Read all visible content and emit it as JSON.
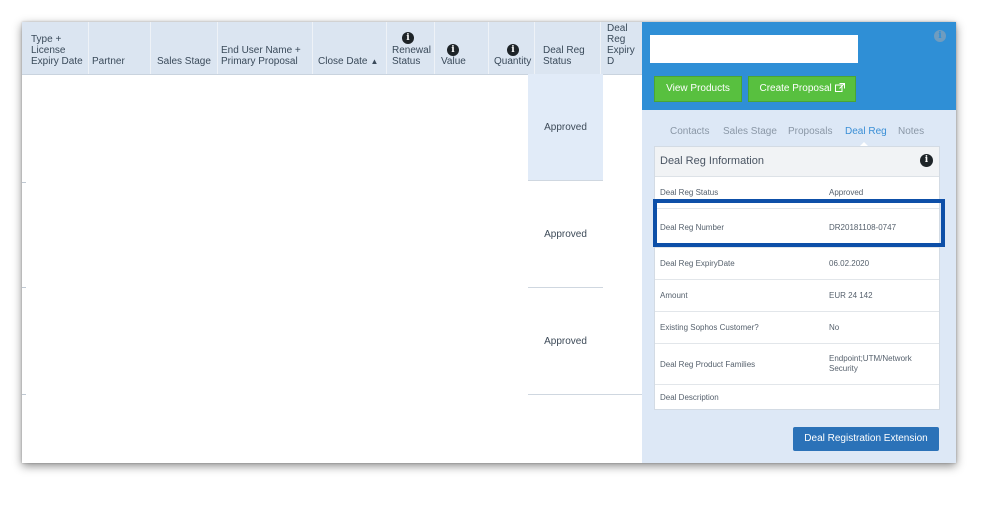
{
  "table": {
    "headers": {
      "type": "Type +",
      "license": "License",
      "expiry": "Expiry Date",
      "partner": "Partner",
      "sales_stage": "Sales Stage",
      "end_user": "End User Name +",
      "primary_proposal": "Primary Proposal",
      "close_date": "Close Date",
      "renewal": "Renewal",
      "renewal_status": "Status",
      "value": "Value",
      "quantity": "Quantity",
      "deal_reg": "Deal Reg",
      "deal_reg_status": "Status",
      "deal_reg_exp": "Deal Reg",
      "deal_reg_exp2": "Expiry D"
    },
    "sort_icon": "▲",
    "rows": [
      {
        "deal_reg_status": "Approved"
      },
      {
        "deal_reg_status": "Approved"
      },
      {
        "deal_reg_status": "Approved"
      }
    ]
  },
  "panel": {
    "view_products": "View Products",
    "create_proposal": "Create Proposal",
    "external_icon": "external-link-icon",
    "tabs": [
      "Contacts",
      "Sales Stage",
      "Proposals",
      "Deal Reg",
      "Notes"
    ],
    "active_tab": "Deal Reg",
    "section_title": "Deal Reg Information",
    "fields": [
      {
        "label": "Deal Reg Status",
        "value": "Approved"
      },
      {
        "label": "Deal Reg Number",
        "value": "DR20181108-0747"
      },
      {
        "label": "Deal Reg ExpiryDate",
        "value": "06.02.2020"
      },
      {
        "label": "Amount",
        "value": "EUR 24 142"
      },
      {
        "label": "Existing Sophos Customer?",
        "value": "No"
      },
      {
        "label": "Deal Reg Product Families",
        "value": "Endpoint;UTM/Network Security"
      },
      {
        "label": "Deal Description",
        "value": ""
      }
    ],
    "extension_button": "Deal Registration Extension"
  },
  "colors": {
    "panel_header": "#2f8fd6",
    "green_button": "#58c03f",
    "highlight_border": "#0d4fa8",
    "extension_button": "#2b72b8"
  }
}
